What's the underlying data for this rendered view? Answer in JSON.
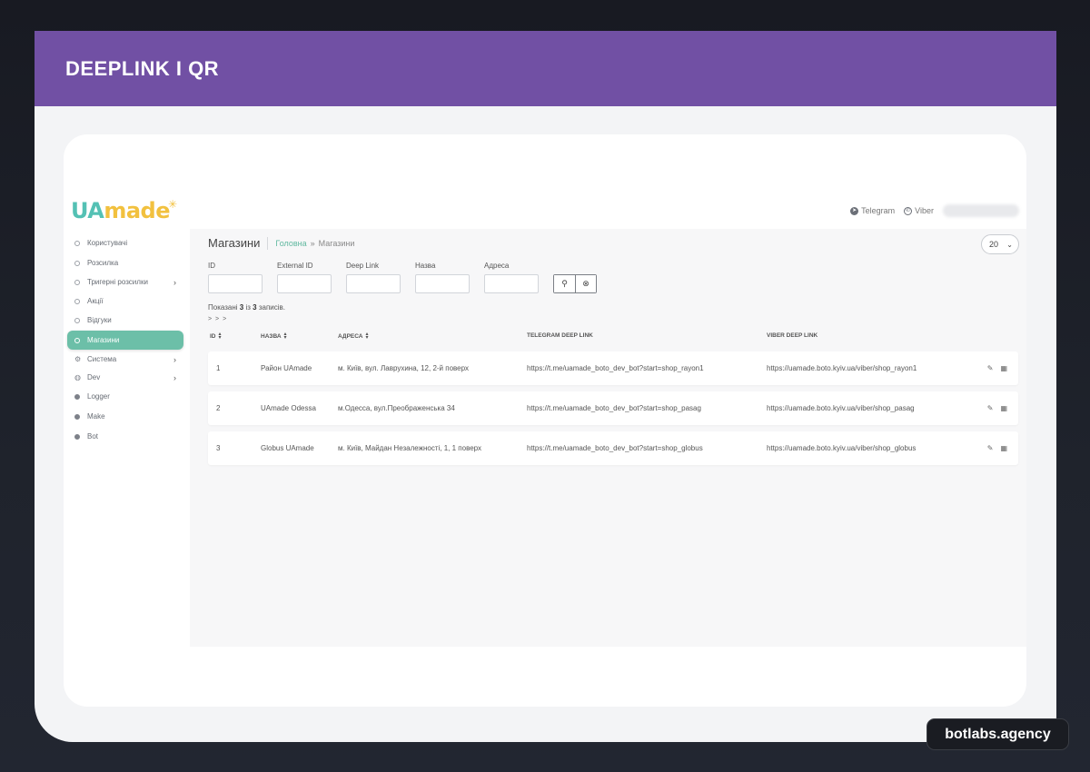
{
  "banner": {
    "title": "DEEPLINK I QR"
  },
  "app": {
    "logo": {
      "part1": "UA",
      "part2": "made"
    },
    "top_links": {
      "telegram": "Telegram",
      "viber": "Viber"
    }
  },
  "sidebar": {
    "items": [
      {
        "label": "Користувачі"
      },
      {
        "label": "Розсилка"
      },
      {
        "label": "Тригерні розсилки"
      },
      {
        "label": "Акції"
      },
      {
        "label": "Відгуки"
      },
      {
        "label": "Магазини"
      },
      {
        "label": "Система"
      },
      {
        "label": "Dev"
      },
      {
        "label": "Logger"
      },
      {
        "label": "Make"
      },
      {
        "label": "Bot"
      }
    ]
  },
  "page": {
    "title": "Магазини",
    "breadcrumb": {
      "home": "Головна",
      "sep": "»",
      "current": "Магазини"
    },
    "per_page": "20"
  },
  "filters": {
    "id": "ID",
    "external_id": "External ID",
    "deep_link": "Deep Link",
    "name": "Назва",
    "address": "Адреса"
  },
  "summary": {
    "prefix": "Показані",
    "shown": "3",
    "mid": "із",
    "total": "3",
    "suffix": "записів.",
    "pager": "> > >"
  },
  "table": {
    "headers": {
      "id": "ID",
      "name": "НАЗВА",
      "address": "АДРЕСА",
      "telegram": "TELEGRAM DEEP LINK",
      "viber": "VIBER DEEP LINK"
    },
    "rows": [
      {
        "id": "1",
        "name": "Район UAmade",
        "address": "м. Київ, вул. Лаврухина, 12, 2-й поверх",
        "telegram": "https://t.me/uamade_boto_dev_bot?start=shop_rayon1",
        "viber": "https://uamade.boto.kyiv.ua/viber/shop_rayon1"
      },
      {
        "id": "2",
        "name": "UAmade Odessa",
        "address": "м.Одесса, вул.Преображенська 34",
        "telegram": "https://t.me/uamade_boto_dev_bot?start=shop_pasag",
        "viber": "https://uamade.boto.kyiv.ua/viber/shop_pasag"
      },
      {
        "id": "3",
        "name": "Globus UAmade",
        "address": "м. Київ, Майдан Незалежності, 1, 1 поверх",
        "telegram": "https://t.me/uamade_boto_dev_bot?start=shop_globus",
        "viber": "https://uamade.boto.kyiv.ua/viber/shop_globus"
      }
    ]
  },
  "footer_badge": "botlabs.agency"
}
